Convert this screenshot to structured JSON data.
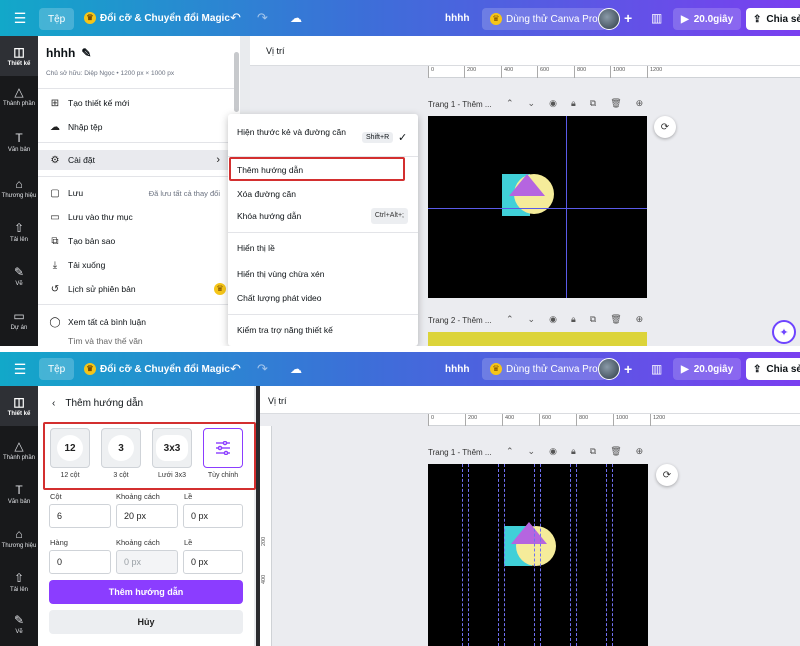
{
  "topbar": {
    "file": "Tệp",
    "magic": "Đổi cỡ & Chuyển đổi Magic",
    "doc_name": "hhhh",
    "try_pro": "Dùng thử Canva Pro",
    "duration": "20.0giây",
    "share": "Chia sẻ",
    "icons": [
      "hamburger-menu-icon",
      "undo-icon",
      "redo-icon",
      "cloud-sync-icon",
      "plus-icon",
      "analytics-icon",
      "play-icon",
      "share-upload-icon"
    ]
  },
  "rail": {
    "items": [
      "Thiết kế",
      "Thành phần",
      "Văn bản",
      "Thương hiệu",
      "Tải lên",
      "Vẽ",
      "Dự án"
    ],
    "icons": [
      "layout-icon",
      "elements-icon",
      "text-icon",
      "brand-icon",
      "upload-icon",
      "draw-icon",
      "folder-icon"
    ]
  },
  "file_menu": {
    "title": "hhhh",
    "owner": "Chủ sở hữu: Diệp Ngọc • 1200 px × 1000 px",
    "items": {
      "new": "Tạo thiết kế mới",
      "import": "Nhập tệp",
      "settings": "Cài đặt",
      "save": "Lưu",
      "saved_status": "Đã lưu tất cả thay đổi",
      "save_to_folder": "Lưu vào thư mục",
      "copy": "Tạo bản sao",
      "download": "Tải xuống",
      "version_history": "Lịch sử phiên bản",
      "view_comments": "Xem tất cả bình luận",
      "find_replace": "Tìm và thay thế văn"
    }
  },
  "settings_submenu": {
    "show_rulers": "Hiện thước kẻ và đường căn",
    "show_rulers_shortcut": "Shift+R",
    "add_guides": "Thêm hướng dẫn",
    "clear_guides": "Xóa đường căn",
    "lock_guides": "Khóa hướng dẫn",
    "lock_guides_shortcut": "Ctrl+Alt+;",
    "show_margins": "Hiển thị lề",
    "show_bleed": "Hiển thị vùng chừa xén",
    "video_quality": "Chất lượng phát video",
    "accessibility": "Kiểm tra trợ năng thiết kế"
  },
  "canvas": {
    "position_label": "Vị trí",
    "page1_label": "Trang 1 - Thêm ...",
    "page2_label": "Trang 2 - Thêm ...",
    "ruler_ticks": [
      "0",
      "200",
      "400",
      "600",
      "800",
      "1000",
      "1200"
    ],
    "vruler_ticks": [
      "200",
      "400"
    ]
  },
  "guides_panel": {
    "back_title": "Thêm hướng dẫn",
    "presets": [
      {
        "badge": "12",
        "label": "12 cột"
      },
      {
        "badge": "3",
        "label": "3 cột"
      },
      {
        "badge": "3x3",
        "label": "Lưới 3x3"
      },
      {
        "badge": "",
        "label": "Tùy chỉnh"
      }
    ],
    "columns_label": "Cột",
    "columns_value": "6",
    "col_gap_label": "Khoảng cách",
    "col_gap_value": "20 px",
    "col_margin_label": "Lề",
    "col_margin_value": "0 px",
    "rows_label": "Hàng",
    "rows_value": "0",
    "row_gap_label": "Khoảng cách",
    "row_gap_value": "0 px",
    "row_margin_label": "Lề",
    "row_margin_value": "0 px",
    "submit": "Thêm hướng dẫn",
    "cancel": "Hủy"
  },
  "colors": {
    "accent": "#8b3dff",
    "highlight": "#d32f2f",
    "guide": "#5a5ae8"
  }
}
